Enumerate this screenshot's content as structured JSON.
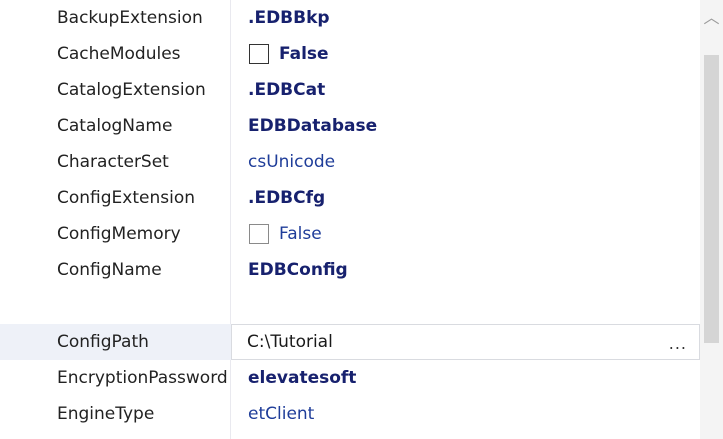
{
  "properties": [
    {
      "name": "BackupExtension",
      "value": ".EDBBkp"
    },
    {
      "name": "CacheModules",
      "value": "False"
    },
    {
      "name": "CatalogExtension",
      "value": ".EDBCat"
    },
    {
      "name": "CatalogName",
      "value": "EDBDatabase"
    },
    {
      "name": "CharacterSet",
      "value": "csUnicode"
    },
    {
      "name": "ConfigExtension",
      "value": ".EDBCfg"
    },
    {
      "name": "ConfigMemory",
      "value": "False"
    },
    {
      "name": "ConfigName",
      "value": "EDBConfig"
    },
    {
      "name": "ConfigPath",
      "value": "C:\\Tutorial",
      "ellipsis": "..."
    },
    {
      "name": "EncryptionPassword",
      "value": "elevatesoft"
    },
    {
      "name": "EngineType",
      "value": "etClient"
    }
  ],
  "scrollbar": {
    "up_arrow_icon": "chevron-up-icon"
  }
}
